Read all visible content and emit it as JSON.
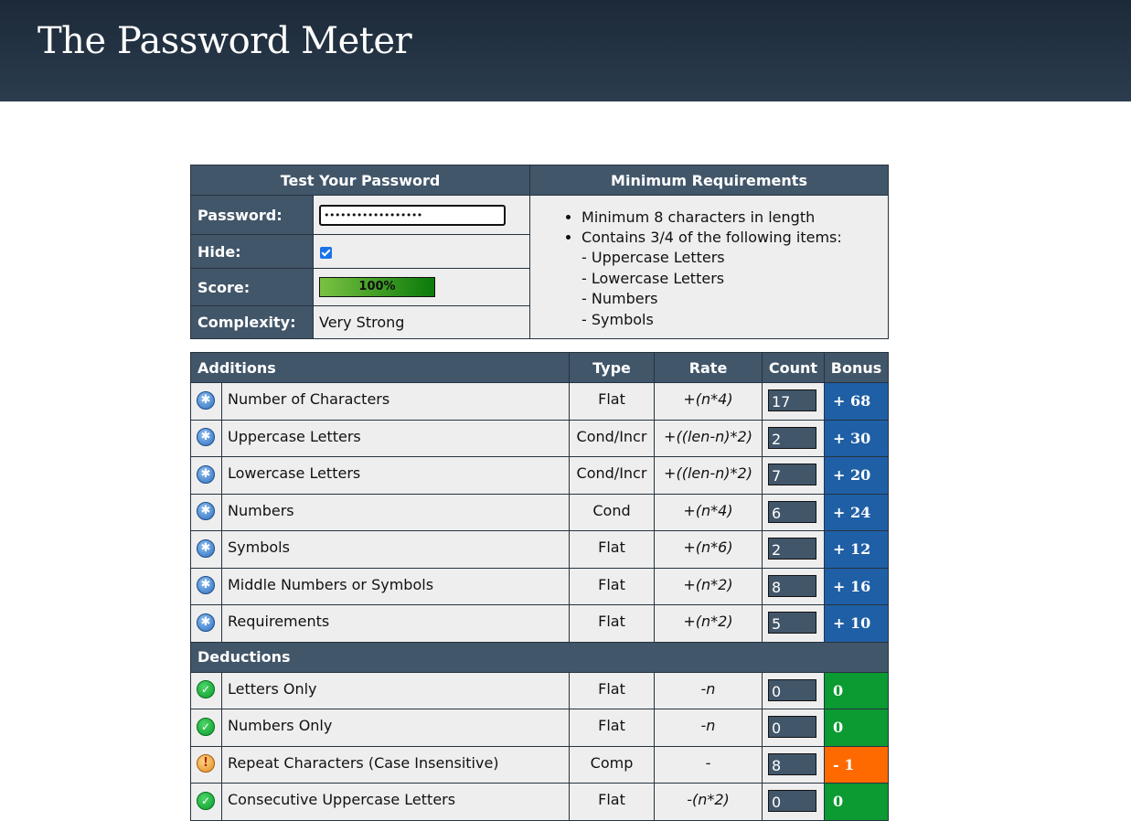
{
  "site_title": "The Password Meter",
  "test": {
    "heading": "Test Your Password",
    "password_label": "Password:",
    "password_value": "••••••••••••••••••",
    "hide_label": "Hide:",
    "score_label": "Score:",
    "score_value": "100%",
    "score_fraction": 1.0,
    "complexity_label": "Complexity:",
    "complexity_value": "Very Strong"
  },
  "requirements": {
    "heading": "Minimum Requirements",
    "items": [
      "Minimum 8 characters in length",
      "Contains 3/4 of the following items:"
    ],
    "subitems": [
      "- Uppercase Letters",
      "- Lowercase Letters",
      "- Numbers",
      "- Symbols"
    ]
  },
  "table": {
    "headers": {
      "additions": "Additions",
      "type": "Type",
      "rate": "Rate",
      "count": "Count",
      "bonus": "Bonus"
    },
    "deductions_heading": "Deductions",
    "additions": [
      {
        "name": "Number of Characters",
        "type": "Flat",
        "rate": "+(n*4)",
        "count": "17",
        "bonus": "+ 68",
        "icon": "plus-icon"
      },
      {
        "name": "Uppercase Letters",
        "type": "Cond/Incr",
        "rate": "+((len-n)*2)",
        "count": "2",
        "bonus": "+ 30",
        "icon": "plus-icon"
      },
      {
        "name": "Lowercase Letters",
        "type": "Cond/Incr",
        "rate": "+((len-n)*2)",
        "count": "7",
        "bonus": "+ 20",
        "icon": "plus-icon"
      },
      {
        "name": "Numbers",
        "type": "Cond",
        "rate": "+(n*4)",
        "count": "6",
        "bonus": "+ 24",
        "icon": "plus-icon"
      },
      {
        "name": "Symbols",
        "type": "Flat",
        "rate": "+(n*6)",
        "count": "2",
        "bonus": "+ 12",
        "icon": "plus-icon"
      },
      {
        "name": "Middle Numbers or Symbols",
        "type": "Flat",
        "rate": "+(n*2)",
        "count": "8",
        "bonus": "+ 16",
        "icon": "plus-icon"
      },
      {
        "name": "Requirements",
        "type": "Flat",
        "rate": "+(n*2)",
        "count": "5",
        "bonus": "+ 10",
        "icon": "plus-icon"
      }
    ],
    "deductions": [
      {
        "name": "Letters Only",
        "type": "Flat",
        "rate": "-n",
        "count": "0",
        "bonus": "0",
        "icon": "check-icon"
      },
      {
        "name": "Numbers Only",
        "type": "Flat",
        "rate": "-n",
        "count": "0",
        "bonus": "0",
        "icon": "check-icon"
      },
      {
        "name": "Repeat Characters (Case Insensitive)",
        "type": "Comp",
        "rate": "-",
        "count": "8",
        "bonus": "- 1",
        "icon": "warning-icon"
      },
      {
        "name": "Consecutive Uppercase Letters",
        "type": "Flat",
        "rate": "-(n*2)",
        "count": "0",
        "bonus": "0",
        "icon": "check-icon"
      }
    ]
  },
  "colors": {
    "header_bg": "#1c2938",
    "panel": "#42566a",
    "bonus_blue": "#1f5fa6",
    "bonus_green": "#0c9a32",
    "bonus_orange": "#ff6a00"
  }
}
